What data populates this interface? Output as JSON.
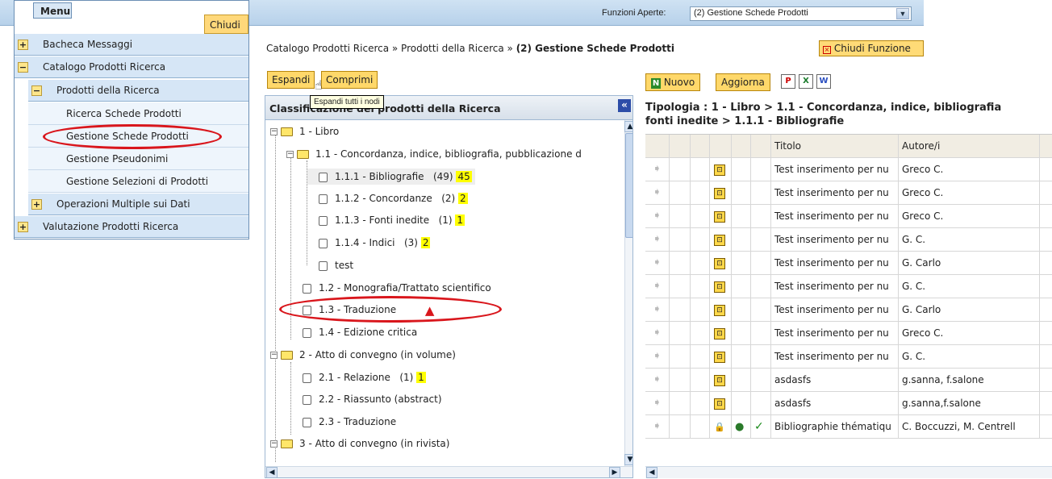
{
  "top": {
    "funzioni_label": "Funzioni Aperte:",
    "funzioni_value": "(2) Gestione Schede Prodotti"
  },
  "menu": {
    "title": "Menu",
    "close": "Chiudi",
    "items": [
      {
        "label": "Bacheca Messaggi",
        "toggle": "+"
      },
      {
        "label": "Catalogo Prodotti Ricerca",
        "toggle": "−"
      },
      {
        "label": "Prodotti della Ricerca",
        "toggle": "−"
      },
      {
        "label": "Ricerca Schede Prodotti"
      },
      {
        "label": "Gestione Schede Prodotti"
      },
      {
        "label": "Gestione Pseudonimi"
      },
      {
        "label": "Gestione Selezioni di Prodotti"
      },
      {
        "label": "Operazioni Multiple sui Dati",
        "toggle": "+"
      },
      {
        "label": "Valutazione Prodotti Ricerca",
        "toggle": "+"
      }
    ]
  },
  "breadcrumb": {
    "part1": "Catalogo Prodotti Ricerca » Prodotti della Ricerca » ",
    "current": "(2) Gestione Schede Prodotti",
    "close_function": "Chiudi Funzione"
  },
  "tree_toolbar": {
    "expand": "Espandi",
    "collapse": "Comprimi",
    "tooltip": "Espandi tutti i nodi"
  },
  "tree": {
    "header": "Classificazione dei prodotti della Ricerca",
    "nodes": [
      {
        "label": "1 - Libro"
      },
      {
        "label": "1.1 - Concordanza, indice, bibliografia, pubblicazione d"
      },
      {
        "label": "1.1.1 - Bibliografie",
        "count": "(49)",
        "badge": "45"
      },
      {
        "label": "1.1.2 - Concordanze",
        "count": "(2)",
        "badge": "2"
      },
      {
        "label": "1.1.3 - Fonti inedite",
        "count": "(1)",
        "badge": "1"
      },
      {
        "label": "1.1.4 - Indici",
        "count": "(3)",
        "badge": "2"
      },
      {
        "label": "test"
      },
      {
        "label": "1.2 - Monografia/Trattato scientifico"
      },
      {
        "label": "1.3 - Traduzione"
      },
      {
        "label": "1.4 - Edizione critica"
      },
      {
        "label": "2 - Atto di convegno (in volume)"
      },
      {
        "label": "2.1 - Relazione",
        "count": "(1)",
        "badge": "1"
      },
      {
        "label": "2.2 - Riassunto (abstract)"
      },
      {
        "label": "2.3 - Traduzione"
      },
      {
        "label": "3 - Atto di convegno (in rivista)"
      }
    ]
  },
  "right_toolbar": {
    "new": "Nuovo",
    "refresh": "Aggiorna"
  },
  "tipologia": {
    "line1": "Tipologia : 1 - Libro > 1.1 - Concordanza, indice, bibliografia",
    "line2": "fonti inedite > 1.1.1 - Bibliografie"
  },
  "grid": {
    "col_title": "Titolo",
    "col_author": "Autore/i",
    "rows": [
      {
        "title": "Test inserimento per nu",
        "author": "Greco C."
      },
      {
        "title": "Test inserimento per nu",
        "author": "Greco C."
      },
      {
        "title": "Test inserimento per nu",
        "author": "Greco C."
      },
      {
        "title": "Test inserimento per nu",
        "author": "G. C."
      },
      {
        "title": "Test inserimento per nu",
        "author": "G. Carlo"
      },
      {
        "title": "Test inserimento per nu",
        "author": "G. C."
      },
      {
        "title": "Test inserimento per nu",
        "author": "G. Carlo"
      },
      {
        "title": "Test inserimento per nu",
        "author": "Greco C."
      },
      {
        "title": "Test inserimento per nu",
        "author": "G. C."
      },
      {
        "title": "asdasfs",
        "author": "g.sanna, f.salone"
      },
      {
        "title": "asdasfs",
        "author": "g.sanna,f.salone"
      },
      {
        "title": "Bibliographie thématiqu",
        "author": "C. Boccuzzi, M. Centrell"
      }
    ]
  },
  "colors": {
    "accent_yellow": "#ffd86a",
    "menu_blue": "#d6e6f6",
    "highlight": "#ffff00",
    "annotation_red": "#d9161c"
  }
}
